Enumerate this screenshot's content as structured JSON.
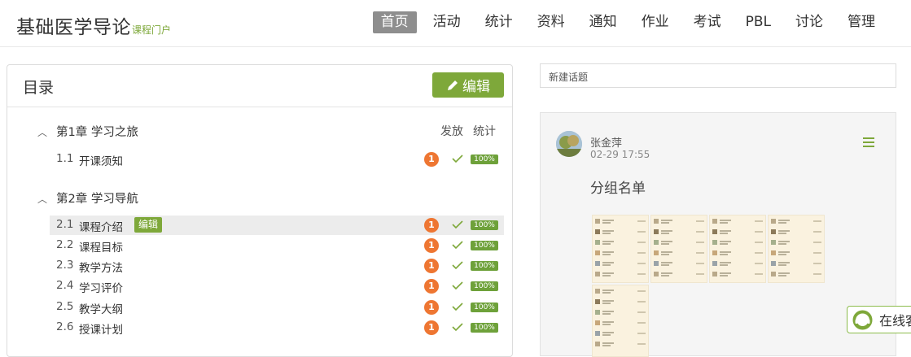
{
  "header": {
    "course_title": "基础医学导论",
    "course_subtitle": "课程门户",
    "nav": [
      "首页",
      "活动",
      "统计",
      "资料",
      "通知",
      "作业",
      "考试",
      "PBL",
      "讨论",
      "管理"
    ]
  },
  "toc": {
    "title": "目录",
    "edit_label": "编辑",
    "col_publish": "发放",
    "col_stats": "统计",
    "chapters": [
      {
        "title": "第1章 学习之旅",
        "lessons": [
          {
            "num": "1.1",
            "label": "开课须知",
            "badge": "1",
            "pct": "100%"
          }
        ]
      },
      {
        "title": "第2章 学习导航",
        "lessons": [
          {
            "num": "2.1",
            "label": "课程介绍",
            "badge": "1",
            "pct": "100%",
            "tag": "编辑"
          },
          {
            "num": "2.2",
            "label": "课程目标",
            "badge": "1",
            "pct": "100%"
          },
          {
            "num": "2.3",
            "label": "教学方法",
            "badge": "1",
            "pct": "100%"
          },
          {
            "num": "2.4",
            "label": "学习评价",
            "badge": "1",
            "pct": "100%"
          },
          {
            "num": "2.5",
            "label": "教学大纲",
            "badge": "1",
            "pct": "100%"
          },
          {
            "num": "2.6",
            "label": "授课计划",
            "badge": "1",
            "pct": "100%"
          }
        ]
      }
    ]
  },
  "discussion": {
    "new_topic_placeholder": "新建话题",
    "post": {
      "author": "张金萍",
      "time": "02-29 17:55",
      "title": "分组名单"
    }
  },
  "service": {
    "label": "在线客"
  },
  "colors": {
    "accent": "#7ea83a",
    "badge": "#ee7632",
    "nav_active": "#8e8e8e"
  },
  "icons": [
    "pencil-icon",
    "caret-up-icon",
    "check-icon",
    "menu-icon",
    "headset-icon",
    "avatar-photo"
  ]
}
